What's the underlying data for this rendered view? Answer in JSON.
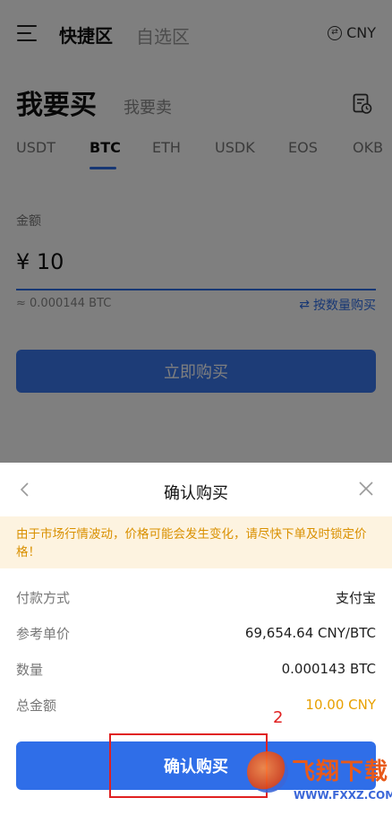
{
  "header": {
    "tabs": [
      "快捷区",
      "自选区"
    ],
    "currency": "CNY"
  },
  "trade": {
    "buy_title": "我要买",
    "sell_title": "我要卖",
    "coins": [
      "USDT",
      "BTC",
      "ETH",
      "USDK",
      "EOS",
      "OKB"
    ],
    "active_coin": "BTC",
    "amount_label": "金额",
    "amount_value": "¥ 10",
    "approx": "≈ 0.000144 BTC",
    "by_quantity": "按数量购买",
    "buy_now": "立即购买"
  },
  "dialog": {
    "title": "确认购买",
    "warning": "由于市场行情波动，价格可能会发生变化，请尽快下单及时锁定价格！",
    "rows": [
      {
        "label": "付款方式",
        "value": "支付宝"
      },
      {
        "label": "参考单价",
        "value": "69,654.64 CNY/BTC"
      },
      {
        "label": "数量",
        "value": "0.000143 BTC"
      },
      {
        "label": "总金额",
        "value": "10.00 CNY"
      }
    ],
    "confirm": "确认购买"
  },
  "annotation": {
    "number": "2",
    "color": "#e02020"
  },
  "watermark": {
    "text": "飞翔下载",
    "url": "WWW.FXXZ.COM"
  },
  "colors": {
    "accent": "#2f6ee8",
    "warning_text": "#d99000",
    "total_amount": "#e8a000"
  },
  "icons": [
    "menu-icon",
    "exchange-icon",
    "order-list-icon",
    "swap-icon",
    "back-chevron-icon",
    "close-icon"
  ]
}
